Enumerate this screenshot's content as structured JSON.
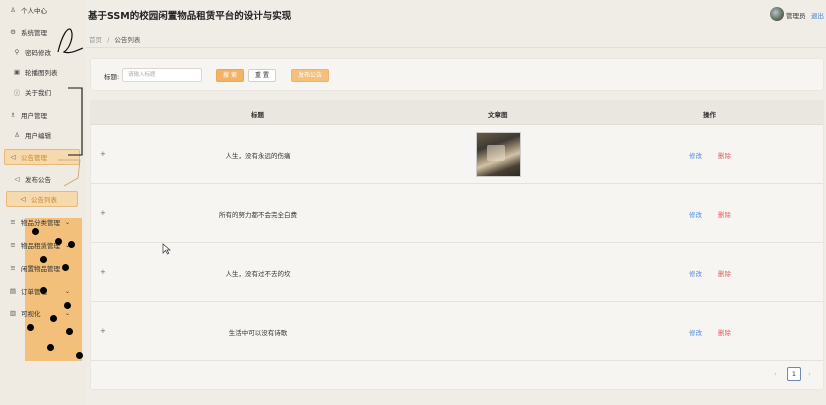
{
  "header": {
    "title": "基于SSM的校园闲置物品租赁平台的设计与实现",
    "user": "管理员",
    "logout": "退出"
  },
  "breadcrumb": {
    "home": "首页",
    "separator": "/",
    "current": "公告列表"
  },
  "sidebar": {
    "items": [
      {
        "icon": "user-icon",
        "glyph": "♙",
        "label": "个人中心"
      },
      {
        "icon": "gear-icon",
        "glyph": "⚙",
        "label": "系统管理"
      },
      {
        "icon": "key-icon",
        "glyph": "⚲",
        "label": "密码修改"
      },
      {
        "icon": "image-icon",
        "glyph": "▣",
        "label": "轮播图列表"
      },
      {
        "icon": "info-icon",
        "glyph": "ⓘ",
        "label": "关于我们"
      },
      {
        "icon": "users-icon",
        "glyph": "♗",
        "label": "用户管理"
      },
      {
        "icon": "user-edit-icon",
        "glyph": "♙",
        "label": "用户编辑"
      },
      {
        "icon": "announce-icon",
        "glyph": "◁",
        "label": "公告管理"
      },
      {
        "icon": "announce-icon",
        "glyph": "◁",
        "label": "发布公告"
      },
      {
        "icon": "announce-icon",
        "glyph": "◁",
        "label": "公告列表"
      },
      {
        "icon": "list-icon",
        "glyph": "≡",
        "label": "物品分类管理"
      },
      {
        "icon": "list-icon",
        "glyph": "≡",
        "label": "物品租赁管理"
      },
      {
        "icon": "list-icon",
        "glyph": "≡",
        "label": "闲置物品管理"
      },
      {
        "icon": "doc-icon",
        "glyph": "▤",
        "label": "订单管理"
      },
      {
        "icon": "chart-icon",
        "glyph": "▥",
        "label": "可视化"
      }
    ]
  },
  "search": {
    "label": "标题:",
    "placeholder": "请输入标题",
    "search_btn": "搜 索",
    "reset_btn": "重 置",
    "publish_btn": "发布公告"
  },
  "table": {
    "columns": [
      "标题",
      "文章图",
      "操作"
    ],
    "rows": [
      {
        "title": "人生，没有永远的伤痛",
        "has_image": true
      },
      {
        "title": "所有的努力都不会完全白费",
        "has_image": false
      },
      {
        "title": "人生，没有过不去的坎",
        "has_image": false
      },
      {
        "title": "生活中可以没有诗歌",
        "has_image": false
      }
    ],
    "edit_label": "修改",
    "delete_label": "删除",
    "expand_glyph": "+"
  },
  "pagination": {
    "current": "1",
    "prev": "‹",
    "next": "›"
  }
}
